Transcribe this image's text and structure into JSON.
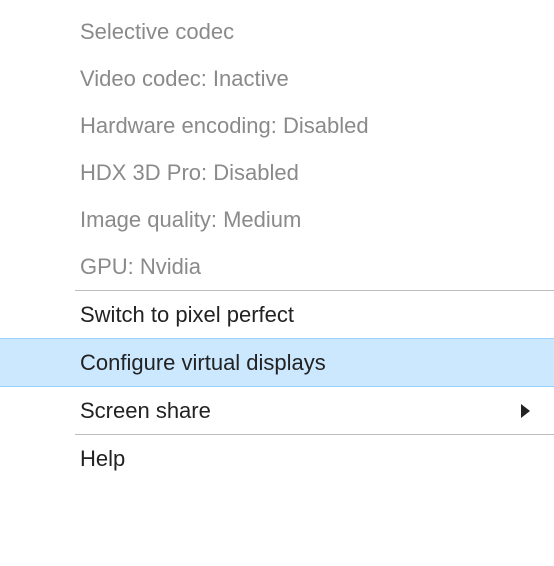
{
  "menu": {
    "info": {
      "selective_codec": "Selective codec",
      "video_codec": "Video codec: Inactive",
      "hw_encoding": "Hardware encoding: Disabled",
      "hdx_3d_pro": "HDX 3D Pro: Disabled",
      "image_quality": "Image quality: Medium",
      "gpu": "GPU: Nvidia"
    },
    "actions": {
      "pixel_perfect": "Switch to pixel perfect",
      "configure_displays": "Configure virtual displays",
      "screen_share": "Screen share",
      "help": "Help"
    }
  },
  "colors": {
    "highlight_bg": "#cce8ff",
    "highlight_border": "#99d1ff",
    "disabled_text": "#8a8a8a",
    "separator": "#bfbfbf"
  }
}
